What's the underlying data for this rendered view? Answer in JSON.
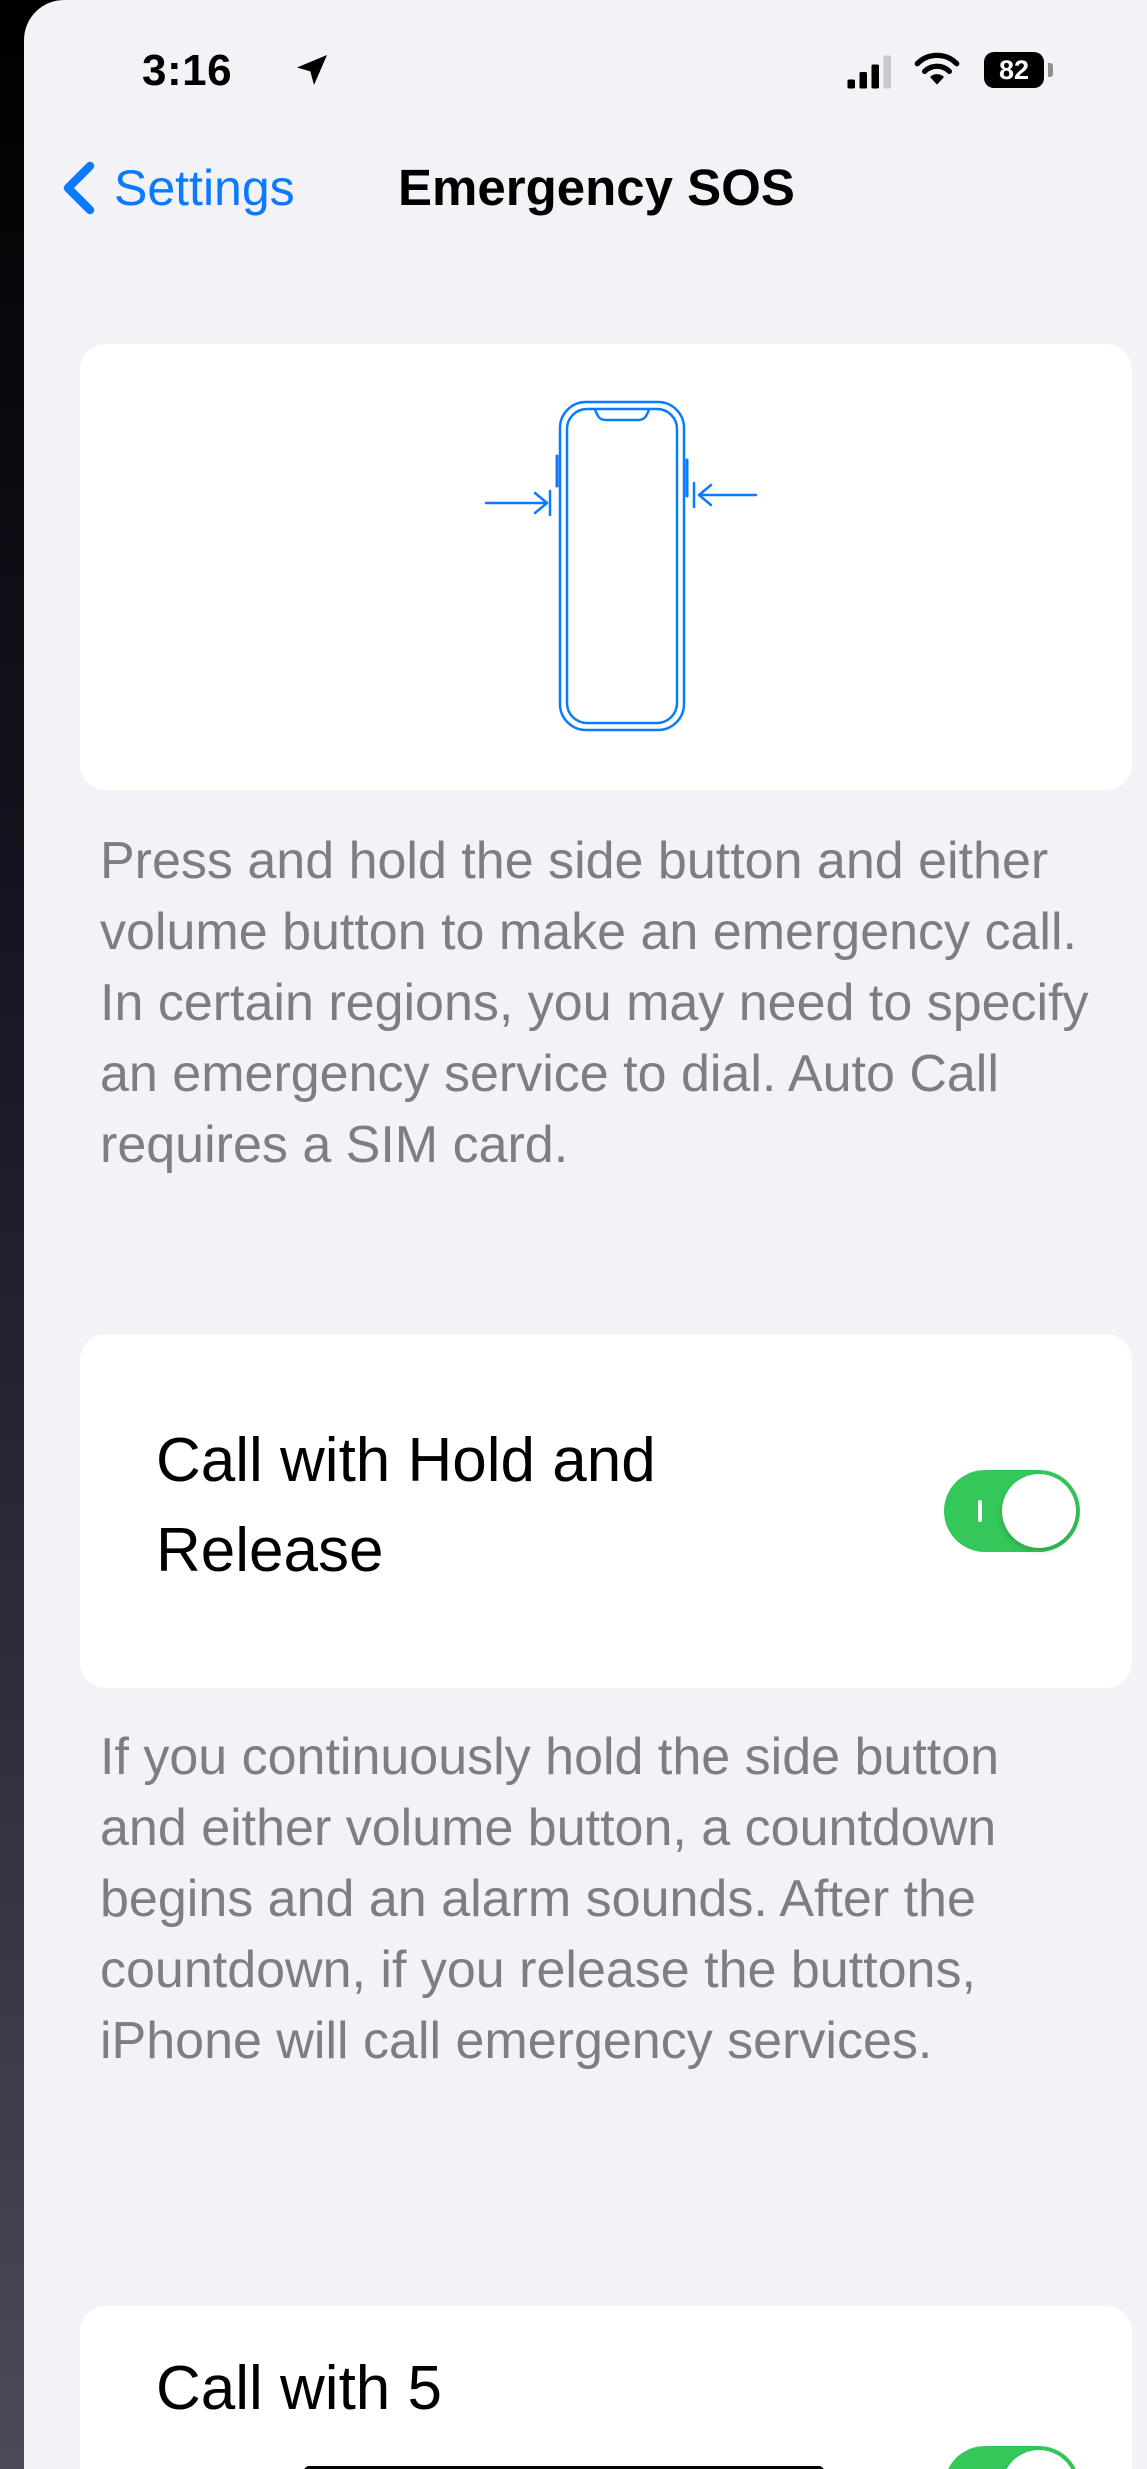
{
  "status_bar": {
    "time": "3:16",
    "battery_level": "82",
    "location_icon": "location-arrow-icon",
    "signal_icon": "cellular-signal-icon",
    "wifi_icon": "wifi-icon"
  },
  "nav": {
    "back_label": "Settings",
    "back_icon": "chevron-left-icon",
    "title": "Emergency SOS"
  },
  "illustration": {
    "icon": "phone-side-buttons-icon"
  },
  "side_button_description": "Press and hold the side button and either volume button to make an emergency call. In certain regions, you may need to specify an emergency service to dial. Auto Call requires a SIM card.",
  "settings": [
    {
      "label": "Call with Hold and Release",
      "enabled": true
    },
    {
      "label": "Call with 5",
      "enabled": true
    }
  ],
  "hold_release_description": "If you continuously hold the side button and either volume button, a countdown begins and an alarm sounds. After the countdown, if you release the buttons, iPhone will call emergency services.",
  "colors": {
    "accent": "#0a7aff",
    "toggle_on": "#34c759",
    "background": "#f2f2f7",
    "secondary_text": "#7d7d82"
  }
}
